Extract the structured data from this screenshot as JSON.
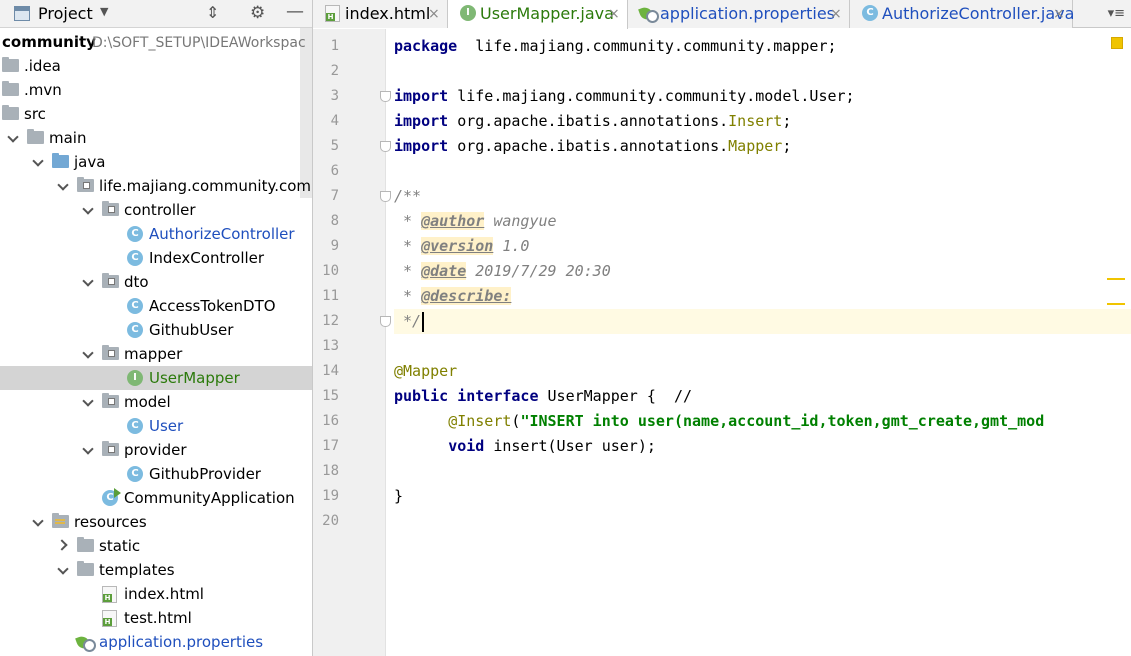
{
  "project_panel": {
    "title": "Project",
    "tree": [
      {
        "label": "community",
        "path": "D:\\SOFT_SETUP\\IDEAWorkspac",
        "type": "root",
        "arrow": "none",
        "indent": 0
      },
      {
        "label": ".idea",
        "type": "folder",
        "arrow": "none",
        "indent": 0
      },
      {
        "label": ".mvn",
        "type": "folder",
        "arrow": "none",
        "indent": 0
      },
      {
        "label": "src",
        "type": "folder",
        "arrow": "none",
        "indent": 0
      },
      {
        "label": "main",
        "type": "folder",
        "arrow": "down",
        "indent": 1
      },
      {
        "label": "java",
        "type": "folder-blue",
        "arrow": "down",
        "indent": 2
      },
      {
        "label": "life.majiang.community.comm",
        "type": "package",
        "arrow": "down",
        "indent": 3
      },
      {
        "label": "controller",
        "type": "package",
        "arrow": "down",
        "indent": 4
      },
      {
        "label": "AuthorizeController",
        "type": "class",
        "arrow": "none",
        "indent": 5,
        "color": "blue"
      },
      {
        "label": "IndexController",
        "type": "class",
        "arrow": "none",
        "indent": 5
      },
      {
        "label": "dto",
        "type": "package",
        "arrow": "down",
        "indent": 4
      },
      {
        "label": "AccessTokenDTO",
        "type": "class",
        "arrow": "none",
        "indent": 5
      },
      {
        "label": "GithubUser",
        "type": "class",
        "arrow": "none",
        "indent": 5
      },
      {
        "label": "mapper",
        "type": "package",
        "arrow": "down",
        "indent": 4
      },
      {
        "label": "UserMapper",
        "type": "interface",
        "arrow": "none",
        "indent": 5,
        "color": "green",
        "selected": true
      },
      {
        "label": "model",
        "type": "package",
        "arrow": "down",
        "indent": 4
      },
      {
        "label": "User",
        "type": "class",
        "arrow": "none",
        "indent": 5,
        "color": "blue"
      },
      {
        "label": "provider",
        "type": "package",
        "arrow": "down",
        "indent": 4
      },
      {
        "label": "GithubProvider",
        "type": "class",
        "arrow": "none",
        "indent": 5
      },
      {
        "label": "CommunityApplication",
        "type": "app-class",
        "arrow": "none",
        "indent": 4
      },
      {
        "label": "resources",
        "type": "resources",
        "arrow": "down",
        "indent": 2
      },
      {
        "label": "static",
        "type": "folder",
        "arrow": "right",
        "indent": 3
      },
      {
        "label": "templates",
        "type": "folder",
        "arrow": "down",
        "indent": 3
      },
      {
        "label": "index.html",
        "type": "html",
        "arrow": "none",
        "indent": 4
      },
      {
        "label": "test.html",
        "type": "html",
        "arrow": "none",
        "indent": 4
      },
      {
        "label": "application.properties",
        "type": "properties",
        "arrow": "none",
        "indent": 3,
        "color": "blue"
      }
    ]
  },
  "tabs": [
    {
      "label": "index.html",
      "icon": "html-file-icon",
      "active": false,
      "color": "black"
    },
    {
      "label": "UserMapper.java",
      "icon": "interface-icon",
      "active": true,
      "color": "green"
    },
    {
      "label": "application.properties",
      "icon": "spring-properties-icon",
      "active": false,
      "color": "blue"
    },
    {
      "label": "AuthorizeController.java",
      "icon": "class-icon",
      "active": false,
      "color": "blue"
    }
  ],
  "tab_close_glyph": "×",
  "tab_menu_glyph": "▾≡",
  "editor": {
    "current_line": 12,
    "lines": [
      {
        "n": "1",
        "tokens": [
          [
            "kw",
            "package"
          ],
          [
            "",
            "  life.majiang.community.community.mapper;"
          ]
        ]
      },
      {
        "n": "2",
        "tokens": []
      },
      {
        "n": "3",
        "tokens": [
          [
            "kw",
            "import"
          ],
          [
            "",
            " life.majiang.community.community.model.User;"
          ]
        ]
      },
      {
        "n": "4",
        "tokens": [
          [
            "kw",
            "import"
          ],
          [
            "",
            " org.apache.ibatis.annotations."
          ],
          [
            "ann",
            "Insert"
          ],
          [
            "",
            ";"
          ]
        ]
      },
      {
        "n": "5",
        "tokens": [
          [
            "kw",
            "import"
          ],
          [
            "",
            " org.apache.ibatis.annotations."
          ],
          [
            "ann",
            "Mapper"
          ],
          [
            "",
            ";"
          ]
        ]
      },
      {
        "n": "6",
        "tokens": []
      },
      {
        "n": "7",
        "tokens": [
          [
            "cmt",
            "/**"
          ]
        ]
      },
      {
        "n": "8",
        "tokens": [
          [
            "cmt",
            " * "
          ],
          [
            "doctag",
            "@author"
          ],
          [
            "cmt",
            " wangyue"
          ]
        ]
      },
      {
        "n": "9",
        "tokens": [
          [
            "cmt",
            " * "
          ],
          [
            "doctag",
            "@version"
          ],
          [
            "cmt",
            " 1.0"
          ]
        ]
      },
      {
        "n": "10",
        "tokens": [
          [
            "cmt",
            " * "
          ],
          [
            "doctag",
            "@date"
          ],
          [
            "cmt",
            " 2019/7/29 20:30"
          ]
        ]
      },
      {
        "n": "11",
        "tokens": [
          [
            "cmt",
            " * "
          ],
          [
            "doctag",
            "@describe:"
          ]
        ]
      },
      {
        "n": "12",
        "tokens": [
          [
            "cmt",
            " */"
          ],
          [
            "caret",
            ""
          ]
        ]
      },
      {
        "n": "13",
        "tokens": []
      },
      {
        "n": "14",
        "tokens": [
          [
            "ann",
            "@Mapper"
          ]
        ]
      },
      {
        "n": "15",
        "tokens": [
          [
            "kw",
            "public"
          ],
          [
            "",
            " "
          ],
          [
            "kw",
            "interface"
          ],
          [
            "",
            " UserMapper {  //"
          ]
        ]
      },
      {
        "n": "16",
        "tokens": [
          [
            "",
            "      "
          ],
          [
            "ann",
            "@Insert"
          ],
          [
            "",
            "("
          ],
          [
            "str",
            "\"INSERT into user(name,account_id,token,gmt_create,gmt_mod"
          ]
        ]
      },
      {
        "n": "17",
        "tokens": [
          [
            "",
            "      "
          ],
          [
            "kw",
            "void"
          ],
          [
            "",
            " insert(User user);"
          ]
        ]
      },
      {
        "n": "18",
        "tokens": []
      },
      {
        "n": "19",
        "tokens": [
          [
            "",
            "}"
          ]
        ]
      },
      {
        "n": "20",
        "tokens": []
      }
    ]
  }
}
